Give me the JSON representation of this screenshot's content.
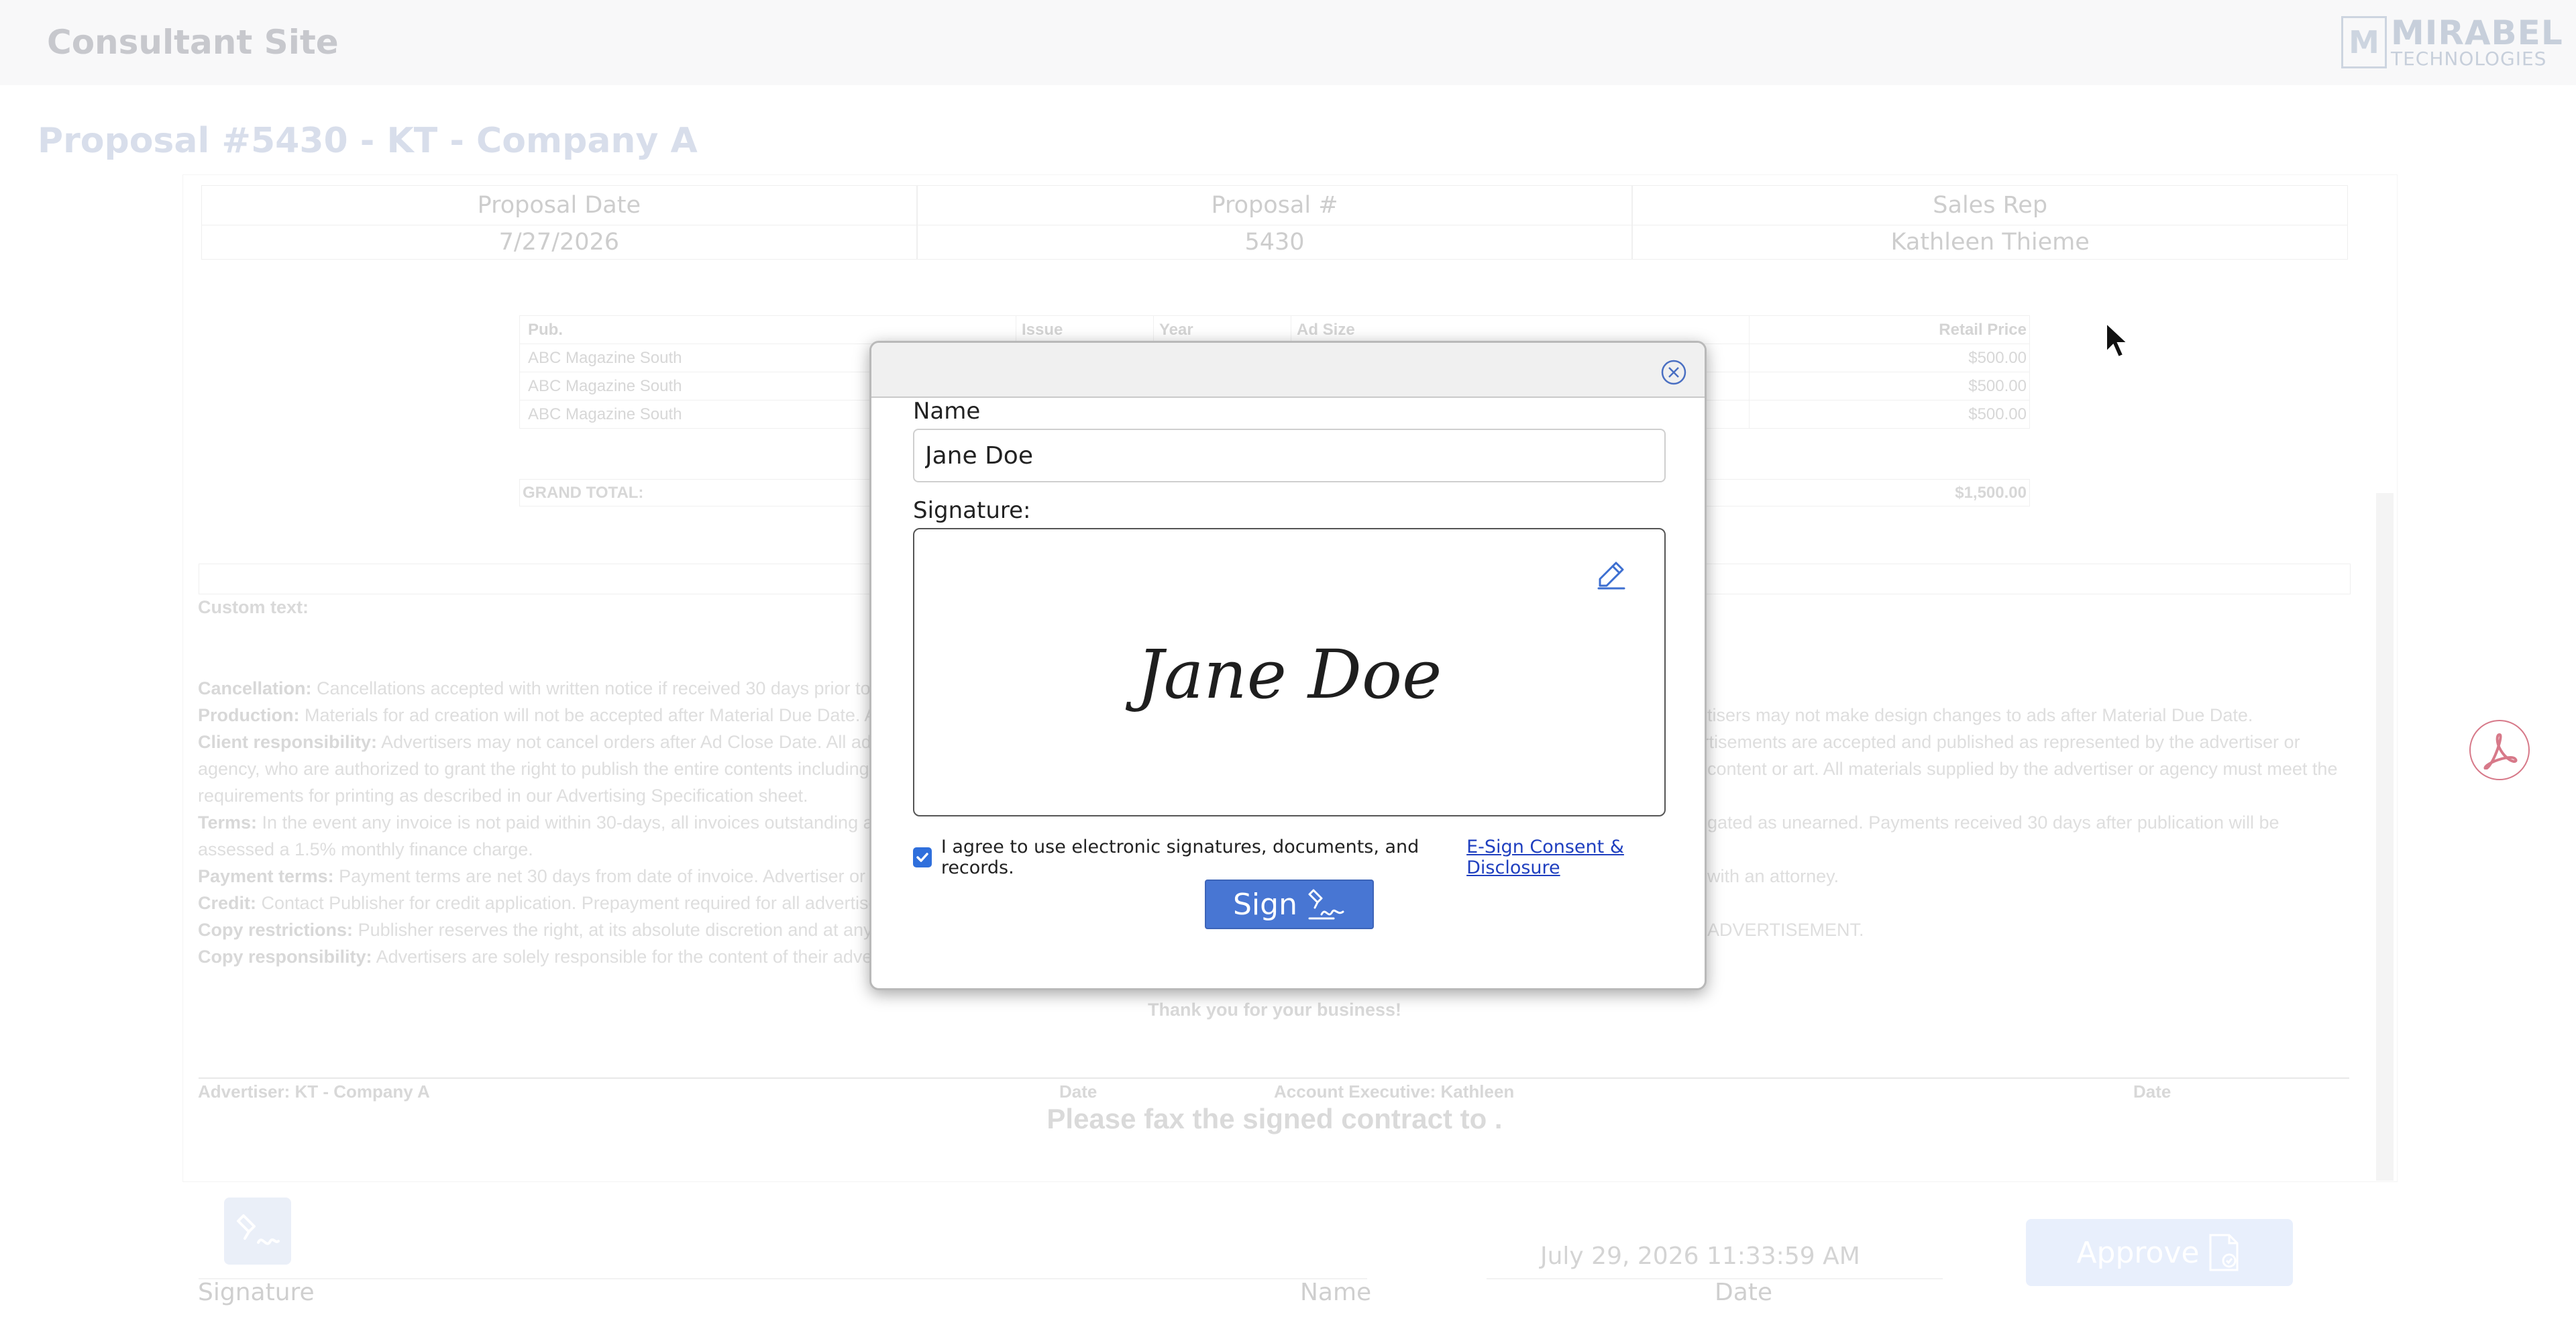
{
  "app": {
    "site_title": "Consultant Site",
    "logo_mark": "M",
    "logo_line1": "MIRABEL",
    "logo_line2": "TECHNOLOGIES"
  },
  "proposal": {
    "title": "Proposal #5430 - KT - Company A",
    "header_labels": [
      "Proposal Date",
      "Proposal #",
      "Sales Rep"
    ],
    "header_values": [
      "7/27/2026",
      "5430",
      "Kathleen Thieme"
    ]
  },
  "items_table": {
    "columns": [
      "Pub.",
      "Issue",
      "Year",
      "Ad Size",
      "Retail Price"
    ],
    "rows": [
      {
        "pub": "ABC Magazine South",
        "price": "$500.00"
      },
      {
        "pub": "ABC Magazine South",
        "price": "$500.00"
      },
      {
        "pub": "ABC Magazine South",
        "price": "$500.00"
      }
    ],
    "grand_total_label": "GRAND TOTAL:",
    "grand_total_value": "$1,500.00"
  },
  "custom_text_label": "Custom text:",
  "terms": [
    {
      "label": "Cancellation:",
      "left": "Cancellations accepted with written notice if received 30 days prior to",
      "right": ""
    },
    {
      "label": "Production:",
      "left": "Materials for ad creation will not be accepted after Material Due Date. A",
      "right": "tisers may not make design changes to ads after Material Due Date."
    },
    {
      "label": "Client responsibility:",
      "left": "Advertisers may not cancel orders after Ad Close Date. All adv",
      "right": "advertisements are accepted and published as represented by the advertiser or"
    },
    {
      "label": "",
      "left": "agency, who are authorized to grant the right to publish the entire contents including",
      "right": "content or art. All materials supplied by the advertiser or agency must meet the"
    },
    {
      "label": "",
      "left": "requirements for printing as described in our Advertising Specification sheet.",
      "right": ""
    },
    {
      "label": "Terms:",
      "left": "In the event any invoice is not paid within 30-days, all invoices outstanding ar",
      "right": "gated as unearned. Payments received 30 days after publication will be"
    },
    {
      "label": "",
      "left": "assessed a 1.5% monthly finance charge.",
      "right": ""
    },
    {
      "label": "Payment terms:",
      "left": "Payment terms are net 30 days from date of invoice. Advertiser or a",
      "right": "with an attorney."
    },
    {
      "label": "Credit:",
      "left": "Contact Publisher for credit application. Prepayment required for all advertise",
      "right": ""
    },
    {
      "label": "Copy restrictions:",
      "left": "Publisher reserves the right, at its absolute discretion and at any",
      "right": "ADVERTISEMENT."
    },
    {
      "label": "Copy responsibility:",
      "left": "Advertisers are solely responsible for the content of their adve",
      "right": ""
    }
  ],
  "thanks": "Thank you for your business!",
  "sign_row": {
    "advertiser": "Advertiser: KT - Company A",
    "date1": "Date",
    "account_exec": "Account Executive:  Kathleen",
    "date2": "Date"
  },
  "fax_note": "Please fax the signed contract to .",
  "footer": {
    "signature_label": "Signature",
    "name_label": "Name",
    "date_label": "Date",
    "date_value": "July 29, 2026 11:33:59 AM",
    "approve_label": "Approve"
  },
  "modal": {
    "name_label": "Name",
    "name_value": "Jane Doe",
    "signature_label": "Signature:",
    "signature_text": "Jane Doe",
    "agree_text": "I agree to use electronic signatures, documents, and records.",
    "agree_link": "E-Sign Consent & Disclosure",
    "agree_checked": true,
    "sign_label": "Sign"
  },
  "colors": {
    "accent": "#4876d3",
    "pdf_red": "#c2324a"
  },
  "icons": [
    "close-icon",
    "pencil-icon",
    "sign-icon",
    "pdf-icon",
    "signature-icon",
    "approve-doc-icon",
    "cursor-icon"
  ]
}
